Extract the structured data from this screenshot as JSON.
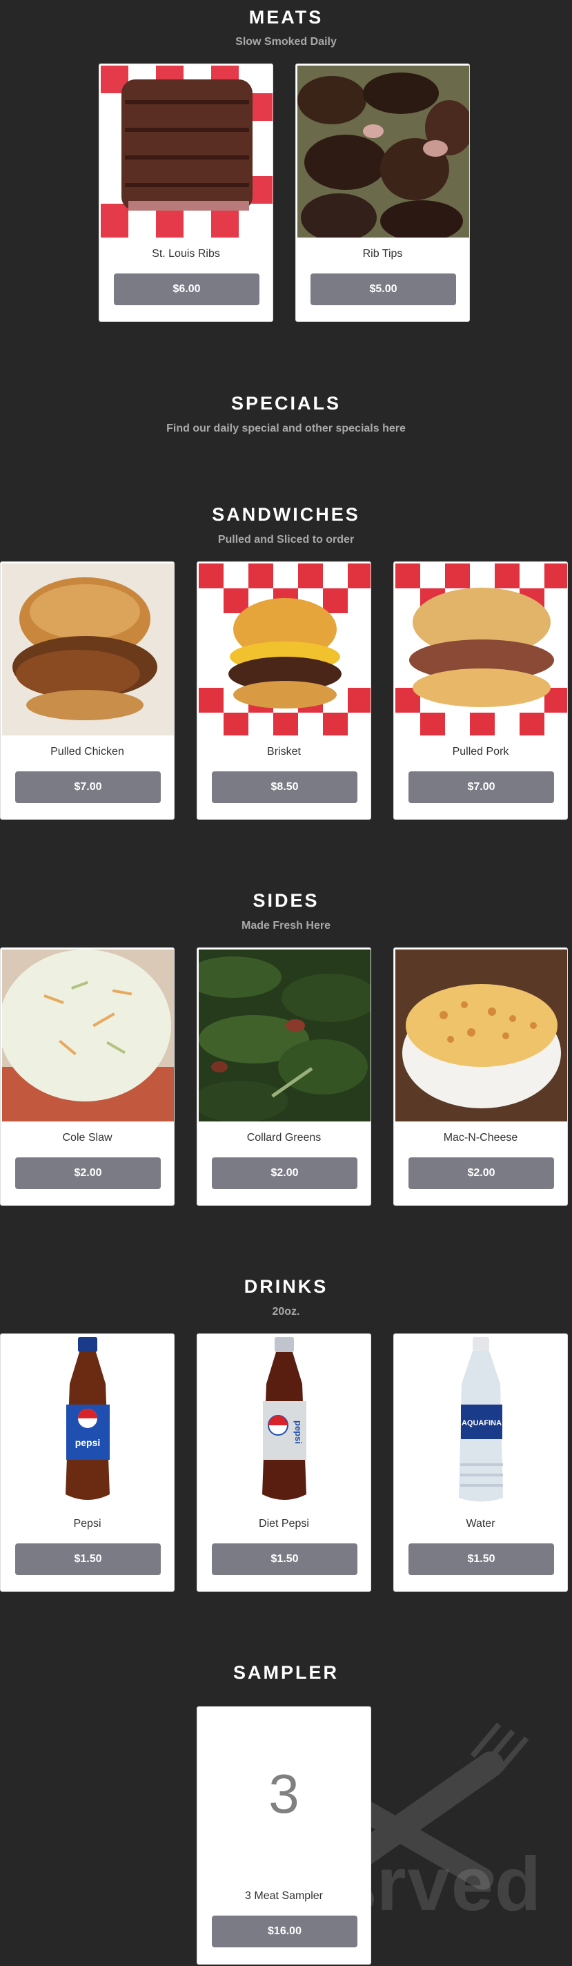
{
  "sections": {
    "meats": {
      "title": "MEATS",
      "subtitle": "Slow Smoked Daily",
      "items": [
        {
          "name": "St. Louis Ribs",
          "price": "$6.00"
        },
        {
          "name": "Rib Tips",
          "price": "$5.00"
        }
      ]
    },
    "specials": {
      "title": "SPECIALS",
      "subtitle": "Find our daily special and other specials here"
    },
    "sandwiches": {
      "title": "SANDWICHES",
      "subtitle": "Pulled and Sliced to order",
      "items": [
        {
          "name": "Pulled Chicken",
          "price": "$7.00"
        },
        {
          "name": "Brisket",
          "price": "$8.50"
        },
        {
          "name": "Pulled Pork",
          "price": "$7.00"
        }
      ]
    },
    "sides": {
      "title": "SIDES",
      "subtitle": "Made Fresh Here",
      "items": [
        {
          "name": "Cole Slaw",
          "price": "$2.00"
        },
        {
          "name": "Collard Greens",
          "price": "$2.00"
        },
        {
          "name": "Mac-N-Cheese",
          "price": "$2.00"
        }
      ]
    },
    "drinks": {
      "title": "DRINKS",
      "subtitle": "20oz.",
      "items": [
        {
          "name": "Pepsi",
          "price": "$1.50",
          "bottle_label": "pepsi"
        },
        {
          "name": "Diet Pepsi",
          "price": "$1.50",
          "bottle_label": "pepsi"
        },
        {
          "name": "Water",
          "price": "$1.50",
          "bottle_label": "AQUAFINA"
        }
      ]
    },
    "sampler": {
      "title": "SAMPLER",
      "items": [
        {
          "number": "3",
          "name": "3 Meat Sampler",
          "price": "$16.00"
        }
      ]
    }
  },
  "watermark": {
    "text": "sirved"
  },
  "colors": {
    "background": "#272727",
    "card": "#ffffff",
    "price_button": "#7b7b86",
    "subtitle": "#a9a9a9"
  }
}
